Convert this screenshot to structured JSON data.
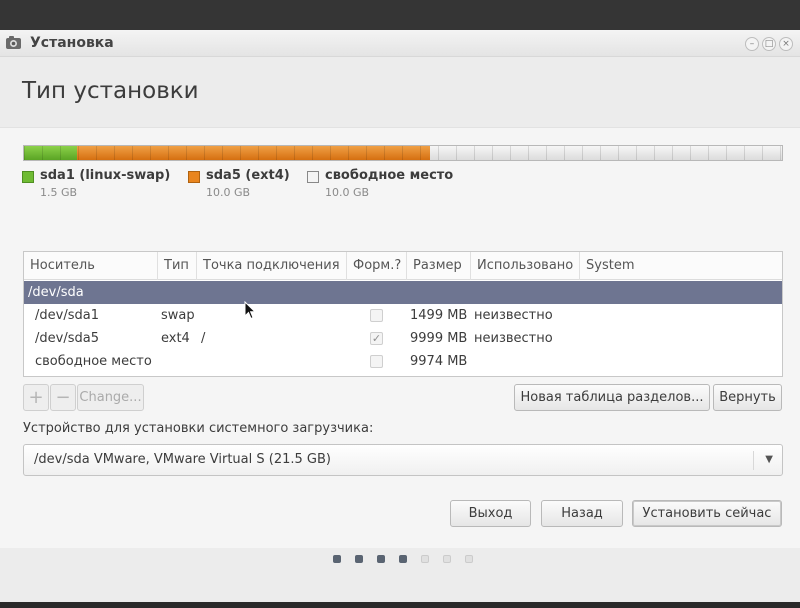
{
  "window": {
    "title": "Установка"
  },
  "page": {
    "title": "Тип установки"
  },
  "partition_bar": {
    "segments": [
      {
        "name": "sda1 (linux-swap)",
        "size": "1.5 GB",
        "color": "#6fbb33",
        "fraction": 0.07
      },
      {
        "name": "sda5 (ext4)",
        "size": "10.0 GB",
        "color": "#e9851e",
        "fraction": 0.465
      },
      {
        "name": "свободное место",
        "size": "10.0 GB",
        "color": "#f4f4f4",
        "fraction": 0.465
      }
    ]
  },
  "table": {
    "headers": [
      "Носитель",
      "Тип",
      "Точка подключения",
      "Форм.?",
      "Размер",
      "Использовано",
      "System"
    ],
    "group": "/dev/sda",
    "rows": [
      {
        "device": "/dev/sda1",
        "type": "swap",
        "mount": "",
        "format": false,
        "size": "1499 MB",
        "used": "неизвестно",
        "system": ""
      },
      {
        "device": "/dev/sda5",
        "type": "ext4",
        "mount": "/",
        "format": true,
        "size": "9999 MB",
        "used": "неизвестно",
        "system": ""
      },
      {
        "device": "свободное место",
        "type": "",
        "mount": "",
        "format": false,
        "size": "9974 MB",
        "used": "",
        "system": ""
      }
    ]
  },
  "toolbar": {
    "add_symbol": "+",
    "remove_symbol": "−",
    "change_label": "Change...",
    "new_table_label": "Новая таблица разделов...",
    "revert_label": "Вернуть"
  },
  "bootloader": {
    "label": "Устройство для установки системного загрузчика:",
    "value": "/dev/sda    VMware, VMware Virtual S (21.5 GB)",
    "arrow": "▼"
  },
  "actions": {
    "quit_label": "Выход",
    "back_label": "Назад",
    "install_label": "Установить сейчас"
  },
  "progress": {
    "total_steps": 7,
    "completed_steps": 4
  }
}
